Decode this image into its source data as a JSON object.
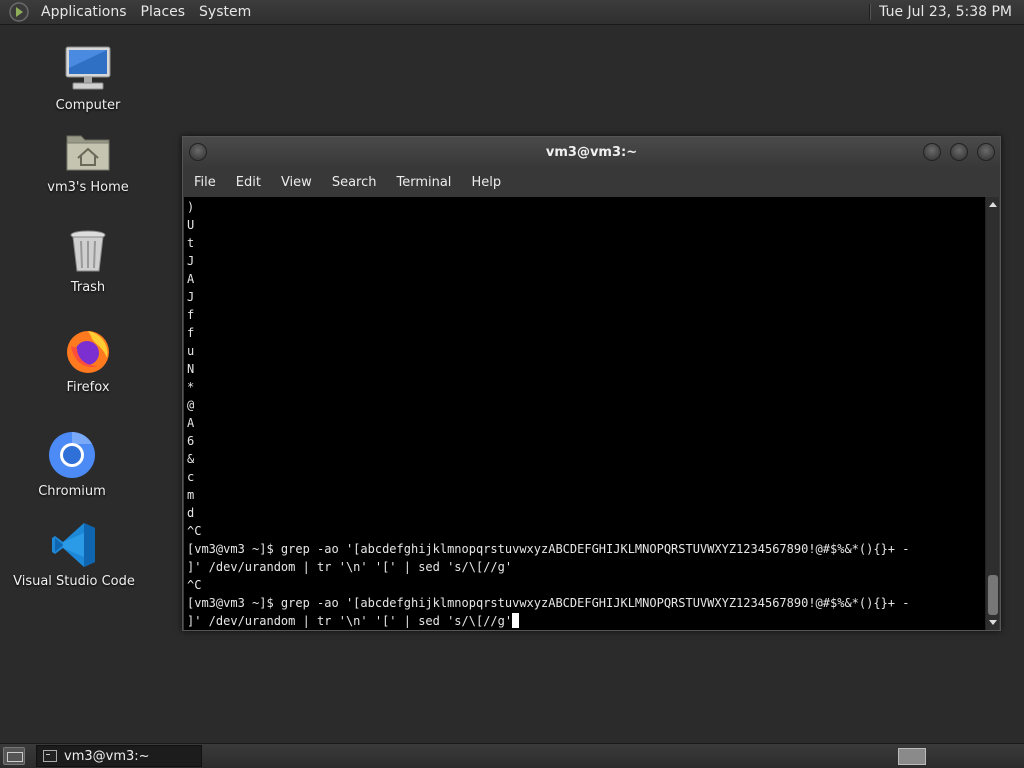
{
  "top_panel": {
    "menus": [
      "Applications",
      "Places",
      "System"
    ],
    "clock": "Tue Jul 23,  5:38 PM"
  },
  "desktop_icons": [
    {
      "label": "Computer",
      "icon": "computer-icon"
    },
    {
      "label": "vm3's Home",
      "icon": "home-folder-icon"
    },
    {
      "label": "Trash",
      "icon": "trash-icon"
    },
    {
      "label": "Firefox",
      "icon": "firefox-icon"
    },
    {
      "label": "Chromium",
      "icon": "chromium-icon"
    },
    {
      "label": "Visual Studio Code",
      "icon": "vscode-icon"
    }
  ],
  "terminal": {
    "title": "vm3@vm3:~",
    "menus": [
      "File",
      "Edit",
      "View",
      "Search",
      "Terminal",
      "Help"
    ],
    "lines": [
      ")",
      "U",
      "t",
      "J",
      "A",
      "J",
      "f",
      "f",
      "u",
      "N",
      "*",
      "@",
      "A",
      "6",
      "&",
      "c",
      "m",
      "d",
      "^C",
      "[vm3@vm3 ~]$ grep -ao '[abcdefghijklmnopqrstuvwxyzABCDEFGHIJKLMNOPQRSTUVWXYZ1234567890!@#$%&*(){}+ -",
      "]' /dev/urandom | tr '\\n' '[' | sed 's/\\[//g'",
      "^C",
      "[vm3@vm3 ~]$ grep -ao '[abcdefghijklmnopqrstuvwxyzABCDEFGHIJKLMNOPQRSTUVWXYZ1234567890!@#$%&*(){}+ -",
      "]' /dev/urandom | tr '\\n' '[' | sed 's/\\[//g'"
    ]
  },
  "taskbar": {
    "task_label": "vm3@vm3:~"
  }
}
